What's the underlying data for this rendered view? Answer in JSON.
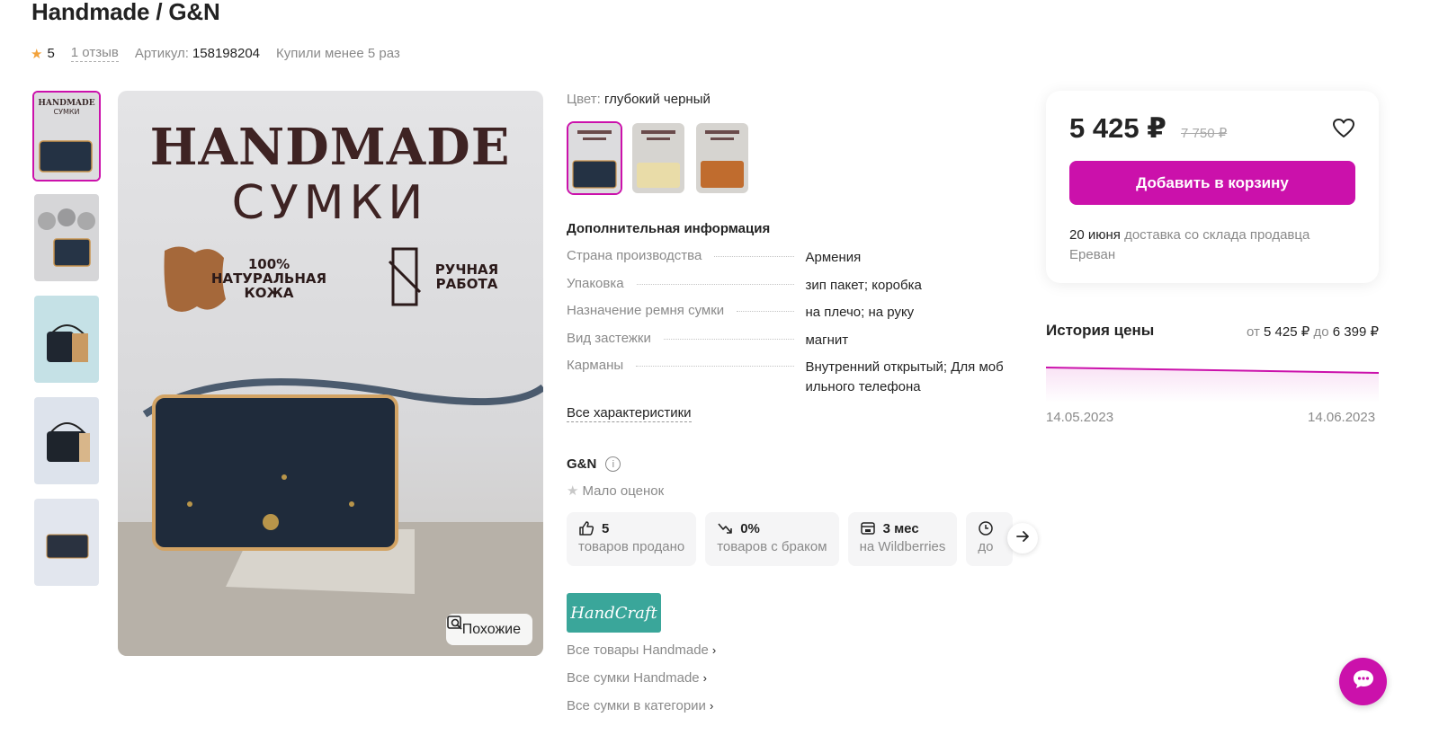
{
  "product": {
    "title": "Handmade / G&N",
    "rating": "5",
    "reviews": "1 отзыв",
    "article_label": "Артикул:",
    "article_value": "158198204",
    "bought": "Купили менее 5 раз"
  },
  "gallery": {
    "main_overlay_title": "HANDMADE",
    "main_overlay_subtitle": "СУМКИ",
    "badge_left": "100% НАТУРАЛЬНАЯ КОЖА",
    "badge_right": "РУЧНАЯ РАБОТА",
    "similar_label": "Похожие",
    "thumb_caption_1": "HANDMADE",
    "thumb_caption_2": "СУМКИ"
  },
  "color": {
    "label": "Цвет:",
    "value": "глубокий черный"
  },
  "info": {
    "title": "Дополнительная информация",
    "specs": [
      {
        "key": "Страна производства",
        "value": "Армения"
      },
      {
        "key": "Упаковка",
        "value": "зип пакет; коробка"
      },
      {
        "key": "Назначение ремня сумки",
        "value": "на плечо; на руку"
      },
      {
        "key": "Вид застежки",
        "value": "магнит"
      },
      {
        "key": "Карманы",
        "value": "Внутренний открытый; Для моб ильного телефона"
      }
    ],
    "all_chars": "Все характеристики"
  },
  "seller": {
    "name": "G&N",
    "rating_text": "Мало оценок",
    "stats": [
      {
        "value": "5",
        "label": "товаров продано",
        "icon": "thumbs-up-icon"
      },
      {
        "value": "0%",
        "label": "товаров с браком",
        "icon": "trend-down-icon"
      },
      {
        "value": "3 мес",
        "label": "на Wildberries",
        "icon": "store-icon"
      },
      {
        "value": "",
        "label": "до",
        "icon": "clock-icon"
      }
    ],
    "logo_text": "HandCraft",
    "links": [
      "Все товары Handmade",
      "Все сумки Handmade",
      "Все сумки в категории"
    ]
  },
  "price": {
    "current": "5 425 ₽",
    "old": "7 750 ₽",
    "cart_button": "Добавить в корзину",
    "delivery_date": "20 июня",
    "delivery_text": "доставка со склада продавца Ереван"
  },
  "price_history": {
    "title": "История цены",
    "from_label": "от",
    "from_value": "5 425 ₽",
    "to_label": "до",
    "to_value": "6 399 ₽",
    "date_start": "14.05.2023",
    "date_end": "14.06.2023"
  },
  "colors": {
    "accent": "#cb11ab",
    "text": "#242424",
    "muted": "#8a8a8a",
    "star": "#f2a23b"
  }
}
